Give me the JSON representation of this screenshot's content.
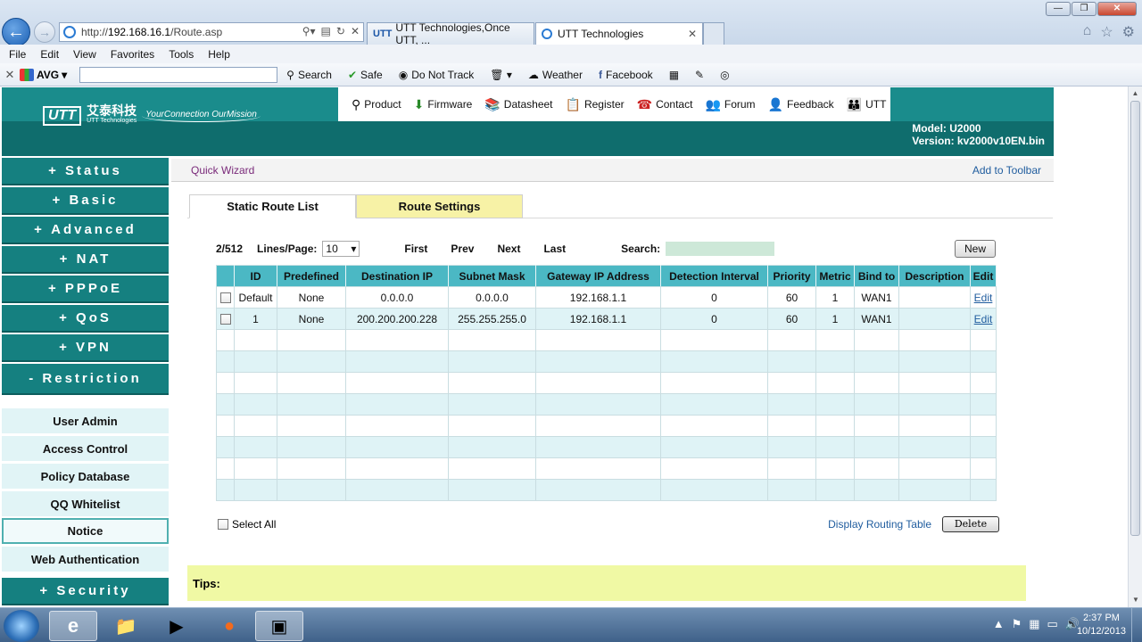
{
  "browser": {
    "address": {
      "prefix": "http://",
      "host": "192.168.16.1",
      "path": "/Route.asp"
    },
    "tabs": [
      {
        "icon": "UTT",
        "label": "UTT Technologies,Once UTT, ...",
        "active": false
      },
      {
        "icon": "",
        "label": "UTT Technologies",
        "active": true
      }
    ],
    "menu": [
      "File",
      "Edit",
      "View",
      "Favorites",
      "Tools",
      "Help"
    ],
    "toolbar": {
      "avg_label": "AVG",
      "search_label": "Search",
      "safe_label": "Safe",
      "dnt_label": "Do Not Track",
      "weather_label": "Weather",
      "facebook_label": "Facebook"
    }
  },
  "header": {
    "logo_brand": "UTT",
    "logo_cn": "艾泰科技",
    "logo_sub": "UTT Technologies",
    "logo_slogan": "YourConnection OurMission",
    "nav": [
      "Product",
      "Firmware",
      "Datasheet",
      "Register",
      "Contact",
      "Forum",
      "Feedback",
      "UTT"
    ],
    "model": "Model: U2000",
    "version": "Version: kv2000v10EN.bin"
  },
  "sidebar": {
    "sections": [
      "Status",
      "Basic",
      "Advanced",
      "NAT",
      "PPPoE",
      "QoS",
      "VPN"
    ],
    "open_section": "Restriction",
    "open_items": [
      "User Admin",
      "Access Control",
      "Policy Database",
      "QQ Whitelist",
      "Notice",
      "Web Authentication"
    ],
    "after_section": "Security"
  },
  "content": {
    "quick_wizard": "Quick Wizard",
    "add_to_toolbar": "Add to Toolbar",
    "tab_static": "Static Route List",
    "tab_settings": "Route Settings",
    "count": "2/512",
    "lines_per_page_label": "Lines/Page:",
    "lines_per_page_value": "10",
    "first": "First",
    "prev": "Prev",
    "next": "Next",
    "last": "Last",
    "search_label": "Search:",
    "new_button": "New",
    "columns": [
      "",
      "ID",
      "Predefined",
      "Destination IP",
      "Subnet Mask",
      "Gateway IP Address",
      "Detection Interval",
      "Priority",
      "Metric",
      "Bind to",
      "Description",
      "Edit"
    ],
    "rows": [
      {
        "id": "Default",
        "predefined": "None",
        "dest": "0.0.0.0",
        "mask": "0.0.0.0",
        "gateway": "192.168.1.1",
        "interval": "0",
        "priority": "60",
        "metric": "1",
        "bind": "WAN1",
        "desc": "",
        "edit": "Edit"
      },
      {
        "id": "1",
        "predefined": "None",
        "dest": "200.200.200.228",
        "mask": "255.255.255.0",
        "gateway": "192.168.1.1",
        "interval": "0",
        "priority": "60",
        "metric": "1",
        "bind": "WAN1",
        "desc": "",
        "edit": "Edit"
      }
    ],
    "empty_rows": 8,
    "select_all": "Select All",
    "display_routing_table": "Display Routing Table",
    "delete_button": "Delete",
    "tips_label": "Tips:"
  },
  "taskbar": {
    "time": "2:37 PM",
    "date": "10/12/2013"
  }
}
